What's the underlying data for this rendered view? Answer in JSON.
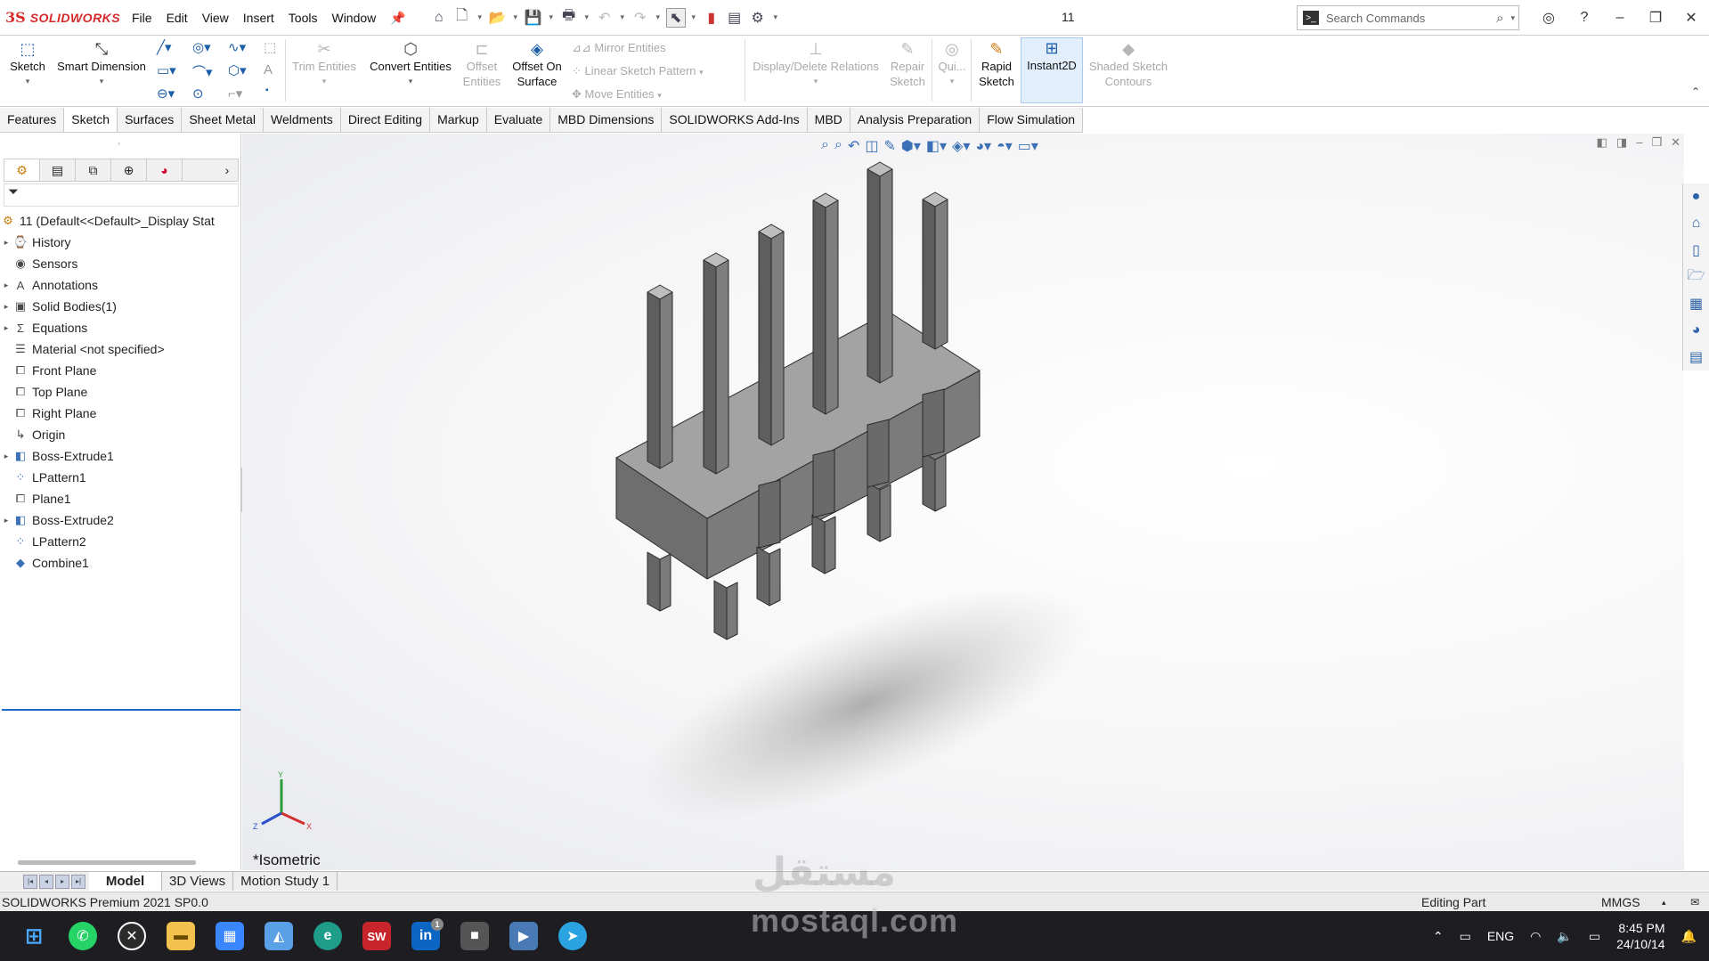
{
  "titlebar": {
    "app_name": "SOLIDWORKS",
    "menus": [
      "File",
      "Edit",
      "View",
      "Insert",
      "Tools",
      "Window"
    ],
    "document": "11",
    "search_placeholder": "Search Commands"
  },
  "ribbon": {
    "sketch": "Sketch",
    "smart_dimension": "Smart Dimension",
    "trim": "Trim Entities",
    "convert": "Convert Entities",
    "offset1": "Offset",
    "offset2": "Entities",
    "offset_surface1": "Offset On",
    "offset_surface2": "Surface",
    "mirror": "Mirror Entities",
    "linear": "Linear Sketch Pattern",
    "move": "Move Entities",
    "display_delete": "Display/Delete Relations",
    "repair1": "Repair",
    "repair2": "Sketch",
    "quick": "Qui...",
    "rapid1": "Rapid",
    "rapid2": "Sketch",
    "instant": "Instant2D",
    "shaded1": "Shaded Sketch",
    "shaded2": "Contours"
  },
  "tabs": [
    "Features",
    "Sketch",
    "Surfaces",
    "Sheet Metal",
    "Weldments",
    "Direct Editing",
    "Markup",
    "Evaluate",
    "MBD Dimensions",
    "SOLIDWORKS Add-Ins",
    "MBD",
    "Analysis Preparation",
    "Flow Simulation"
  ],
  "tree": {
    "root": "11  (Default<<Default>_Display Stat",
    "items": [
      "History",
      "Sensors",
      "Annotations",
      "Solid Bodies(1)",
      "Equations",
      "Material <not specified>",
      "Front Plane",
      "Top Plane",
      "Right Plane",
      "Origin",
      "Boss-Extrude1",
      "LPattern1",
      "Plane1",
      "Boss-Extrude2",
      "LPattern2",
      "Combine1"
    ]
  },
  "viewport": {
    "view_name": "*Isometric"
  },
  "bottom_tabs": [
    "Model",
    "3D Views",
    "Motion Study 1"
  ],
  "status": {
    "left": "SOLIDWORKS Premium 2021 SP0.0",
    "mode": "Editing Part",
    "units": "MMGS"
  },
  "taskbar": {
    "lang": "ENG",
    "time": "8:45 PM",
    "date": "24/10/14",
    "badge": "1"
  },
  "watermark": {
    "arabic": "مستقل",
    "latin": "mostaql.com"
  }
}
